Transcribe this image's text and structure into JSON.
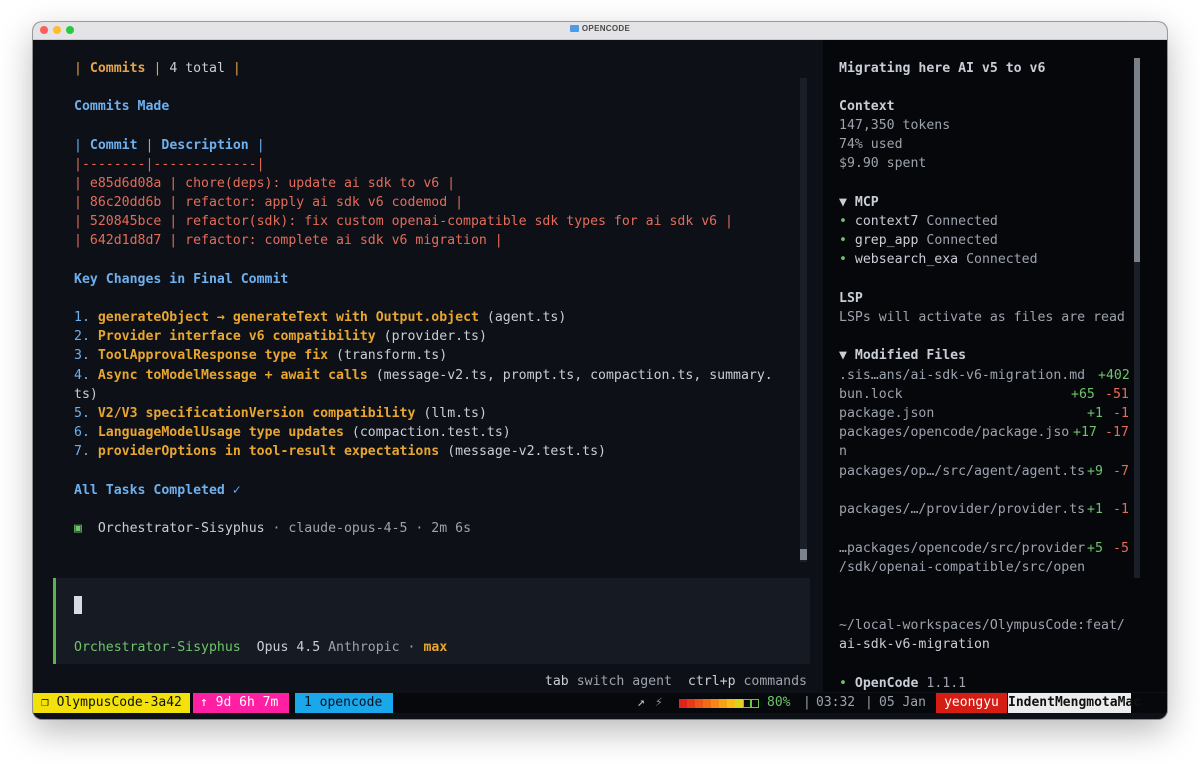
{
  "window": {
    "title": "OPENCODE"
  },
  "transcript": {
    "commits_header": {
      "pipe1": "|",
      "label": "Commits",
      "pipe2": "|",
      "count": "4 total",
      "pipe3": "|"
    },
    "commits_made": "Commits Made",
    "table_header": {
      "pipe1": "|",
      "col1": "Commit",
      "pipe2": "|",
      "col2": "Description",
      "pipe3": "|"
    },
    "table_sep": "|--------|-------------|",
    "rows": [
      "| e85d6d08a | chore(deps): update ai sdk to v6 |",
      "| 86c20dd6b | refactor: apply ai sdk v6 codemod |",
      "| 520845bce | refactor(sdk): fix custom openai-compatible sdk types for ai sdk v6 |",
      "| 642d1d8d7 | refactor: complete ai sdk v6 migration |"
    ],
    "key_changes": "Key Changes in Final Commit",
    "changes": [
      {
        "num": "1.",
        "text": "generateObject → generateText with Output.object",
        "file": " (agent.ts)"
      },
      {
        "num": "2.",
        "text": "Provider interface v6 compatibility",
        "file": " (provider.ts)"
      },
      {
        "num": "3.",
        "text": "ToolApprovalResponse type fix",
        "file": " (transform.ts)"
      },
      {
        "num": "4.",
        "text": "Async toModelMessage + await calls",
        "file": " (message-v2.ts, prompt.ts, compaction.ts, summary."
      },
      {
        "num": "",
        "text": "",
        "file": "ts)"
      },
      {
        "num": "5.",
        "text": "V2/V3 specificationVersion compatibility",
        "file": " (llm.ts)"
      },
      {
        "num": "6.",
        "text": "LanguageModelUsage type updates",
        "file": " (compaction.test.ts)"
      },
      {
        "num": "7.",
        "text": "providerOptions in tool-result expectations",
        "file": " (message-v2.test.ts)"
      }
    ],
    "all_done": "All Tasks Completed ✓",
    "agent_line": {
      "icon": "▣",
      "agent": "Orchestrator-Sisyphus",
      "rest": " · claude-opus-4-5 · 2m 6s"
    }
  },
  "input": {
    "agent": "Orchestrator-Sisyphus",
    "model": "Opus 4.5",
    "provider": "Anthropic",
    "sep": "·",
    "variant": "max"
  },
  "hints": {
    "k1": "tab",
    "a1": "switch agent",
    "k2": "ctrl+p",
    "a2": "commands"
  },
  "sidebar": {
    "title": "Migrating here AI v5 to v6",
    "context": {
      "label": "Context",
      "tokens": "147,350 tokens",
      "used": "74% used",
      "spent": "$9.90 spent"
    },
    "mcp": {
      "label": "▼ MCP",
      "items": [
        {
          "name": "context7",
          "status": "Connected"
        },
        {
          "name": "grep_app",
          "status": "Connected"
        },
        {
          "name": "websearch_exa",
          "status": "Connected"
        }
      ]
    },
    "lsp": {
      "label": "LSP",
      "text": "LSPs will activate as files are read"
    },
    "modified": {
      "label": "▼ Modified Files",
      "files": [
        {
          "path": ".sis…ans/ai-sdk-v6-migration.md",
          "add": "+402",
          "del": ""
        },
        {
          "path": "bun.lock",
          "add": "+65",
          "del": "-51"
        },
        {
          "path": "package.json",
          "add": "+1",
          "del": "-1"
        },
        {
          "path": "packages/opencode/package.jso",
          "path2": "n",
          "add": "+17",
          "del": "-17"
        },
        {
          "path": "packages/op…/src/agent/agent.ts",
          "add": "+9",
          "del": "-7"
        },
        {
          "path": "packages/…/provider/provider.ts",
          "add": "+1",
          "del": "-1"
        },
        {
          "path": "…packages/opencode/src/provider",
          "path2": "/sdk/openai-compatible/src/open",
          "add": "+5",
          "del": "-5"
        }
      ]
    },
    "cwd_dim": "~/local-workspaces/OlympusCode:feat/",
    "cwd_branch": "ai-sdk-v6-migration",
    "app": {
      "name": "OpenCode",
      "version": "1.1.1"
    }
  },
  "status": {
    "session": "❐ OlympusCode-3a42",
    "uptime": "↑ 9d 6h 7m",
    "window": "1 opencode",
    "battery_pct": "80%",
    "battery_level": 0.8,
    "sep1": "|",
    "time": "03:32",
    "sep2": "|",
    "date": "05 Jan",
    "user": "yeongyu",
    "host": "IndentMengmotaMac"
  }
}
